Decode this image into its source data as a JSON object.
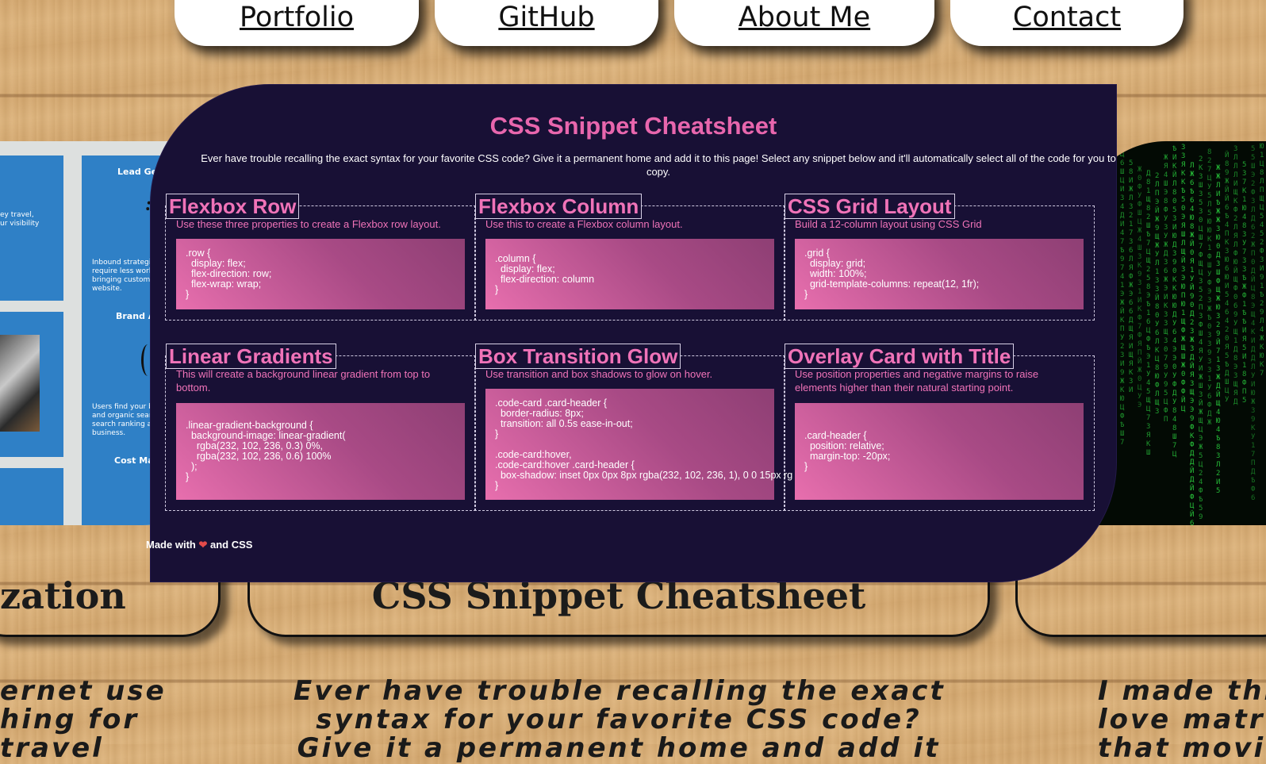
{
  "nav": {
    "items": [
      {
        "label": "Portfolio"
      },
      {
        "label": "GitHub"
      },
      {
        "label": "About Me"
      },
      {
        "label": "Contact"
      }
    ]
  },
  "left_card": {
    "headings": [
      "Lead Generatio",
      "Brand A",
      "Cost Ma"
    ],
    "texts": [
      "ey travel,\nur visibility",
      "Inbound strategies\nrequire less work t\nbringing customer\nwebsite.",
      "Users find your bu\nand organic search\nsearch ranking and\nbusiness."
    ]
  },
  "projects": [
    {
      "title": "zation",
      "description": "ernet use\nhing for\ntravel"
    },
    {
      "title": "CSS Snippet Cheatsheet",
      "description": "Ever have trouble recalling the exact\nsyntax for your favorite CSS code?\nGive it a permanent home and add it"
    },
    {
      "title": "",
      "description": "I made this\nlove matr\nthat movie"
    }
  ],
  "cheatsheet": {
    "title": "CSS Snippet Cheatsheet",
    "intro": "Ever have trouble recalling the exact syntax for your favorite CSS code? Give it a permanent home and add it to this page! Select any snippet below and it'll automatically select all of the code for you to copy.",
    "snippets": [
      {
        "title": "Flexbox Row",
        "description": "Use these three properties to create a Flexbox row layout.",
        "code": ".row {\n  display: flex;\n  flex-direction: row;\n  flex-wrap: wrap;\n}"
      },
      {
        "title": "Flexbox Column",
        "description": "Use this to create a Flexbox column layout.",
        "code": ".column {\n  display: flex;\n  flex-direction: column\n}"
      },
      {
        "title": "CSS Grid Layout",
        "description": "Build a 12-column layout using CSS Grid",
        "code": ".grid {\n  display: grid;\n  width: 100%;\n  grid-template-columns: repeat(12, 1fr);\n}"
      },
      {
        "title": "Linear Gradients",
        "description": "This will create a background linear gradient from top to bottom.",
        "code": ".linear-gradient-background {\n  background-image: linear-gradient(\n    rgba(232, 102, 236, 0.3) 0%,\n    rgba(232, 102, 236, 0.6) 100%\n  );\n}"
      },
      {
        "title": "Box Transition Glow",
        "description": "Use transition and box shadows to glow on hover.",
        "code": ".code-card .card-header {\n  border-radius: 8px;\n  transition: all 0.5s ease-in-out;\n}\n\n.code-card:hover,\n.code-card:hover .card-header {\n  box-shadow: inset 0px 0px 8px rgba(232, 102, 236, 1), 0 0 15px rg\n}"
      },
      {
        "title": "Overlay Card with Title",
        "description": "Use position properties and negative margins to raise elements higher than their natural starting point.",
        "code": ".card-header {\n  position: relative;\n  margin-top: -20px;\n}"
      }
    ],
    "footer_prefix": "Made with ",
    "footer_heart": "❤",
    "footer_suffix": " and CSS"
  },
  "colors": {
    "accent": "#e866ad",
    "overlay_bg": "#181035",
    "matrix_green": "#27c23a"
  }
}
